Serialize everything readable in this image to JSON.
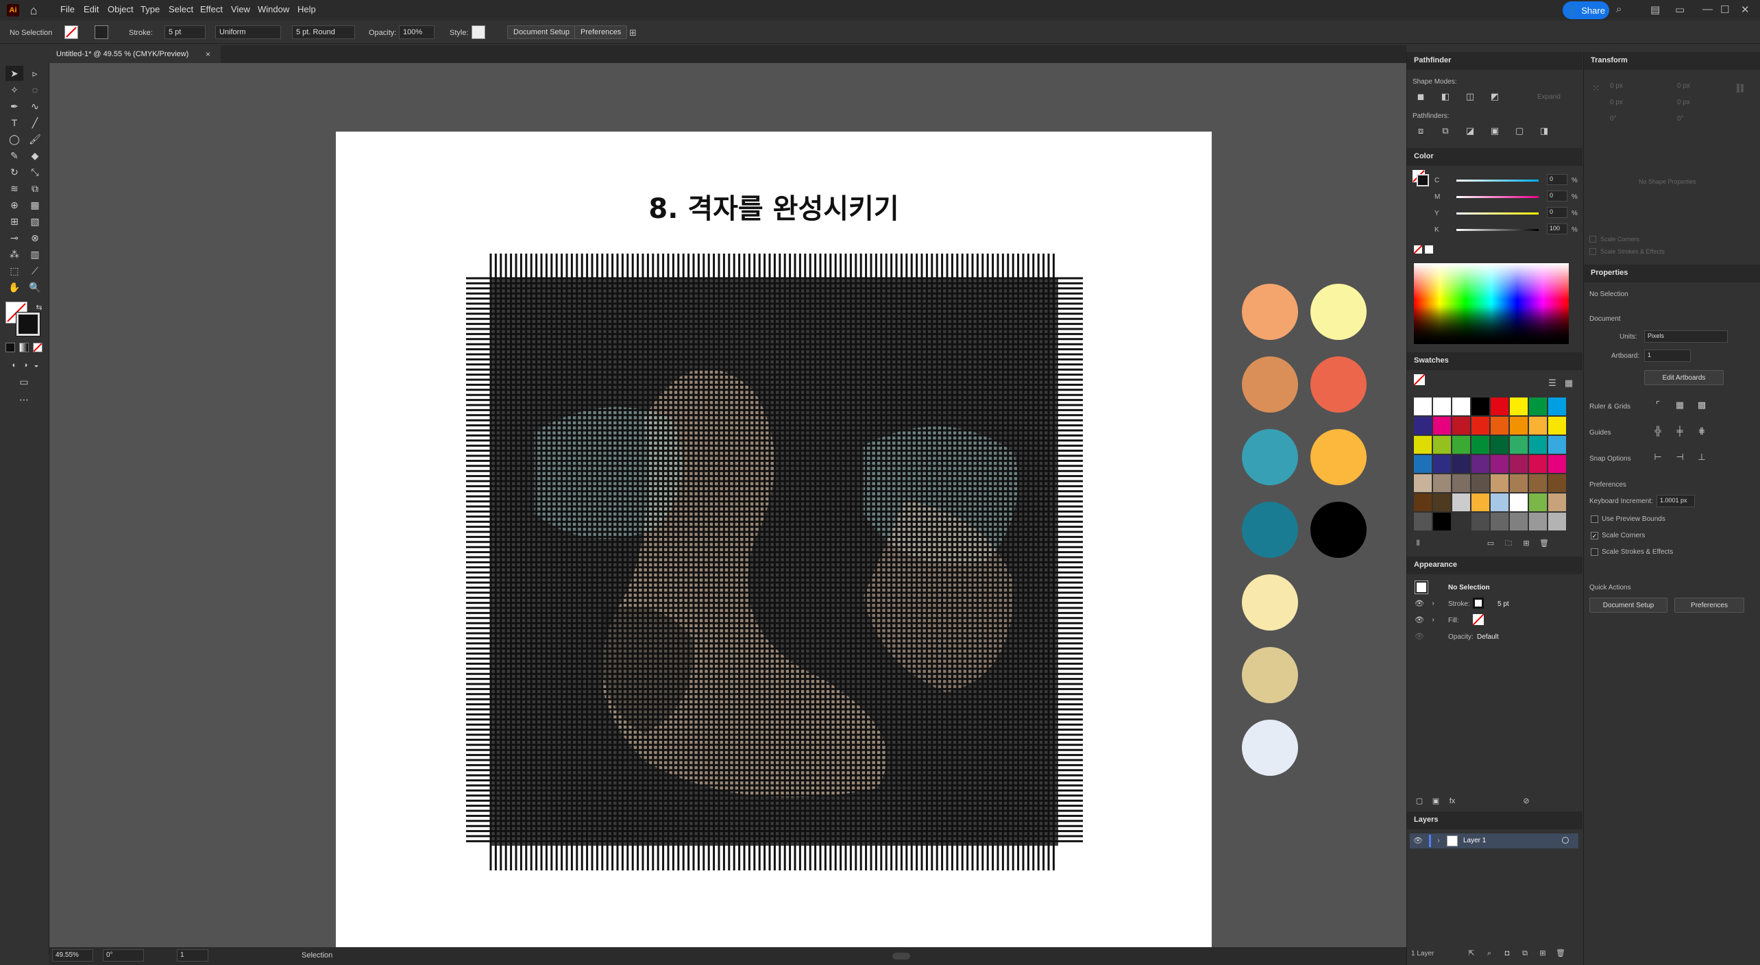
{
  "app": {
    "logo": "Ai",
    "menu": [
      "File",
      "Edit",
      "Object",
      "Type",
      "Select",
      "Effect",
      "View",
      "Window",
      "Help"
    ],
    "share_label": "Share"
  },
  "control_bar": {
    "selection_status": "No Selection",
    "stroke_label": "Stroke:",
    "stroke_value": "5 pt",
    "profile_value": "Uniform",
    "brush_value": "5 pt. Round",
    "opacity_label": "Opacity:",
    "opacity_value": "100%",
    "style_label": "Style:",
    "document_setup": "Document Setup",
    "preferences": "Preferences"
  },
  "document": {
    "tab_title": "Untitled-1* @ 49.55 % (CMYK/Preview)",
    "artboard_title": "8. 격자를 완성시키기"
  },
  "palette": {
    "colors": [
      "#f4a56e",
      "#faf5a0",
      "#da8f58",
      "#ec664b",
      "#38a0b4",
      "#fbb83c",
      "#1a7c93",
      "#000000",
      "#f9e8ac",
      "#decb92",
      "#e6ecf5"
    ]
  },
  "status_bar": {
    "zoom": "49.55%",
    "rotation": "0°",
    "artboard_num": "1",
    "tool_name": "Selection"
  },
  "pathfinder": {
    "title": "Pathfinder",
    "shape_modes_label": "Shape Modes:",
    "pathfinders_label": "Pathfinders:",
    "expand_label": "Expand"
  },
  "color_panel": {
    "title": "Color",
    "channels": [
      {
        "name": "C",
        "value": "0"
      },
      {
        "name": "M",
        "value": "0"
      },
      {
        "name": "Y",
        "value": "0"
      },
      {
        "name": "K",
        "value": "100"
      }
    ],
    "unit": "%"
  },
  "swatches": {
    "title": "Swatches",
    "rows": [
      [
        "#ffffff",
        "#ffffff",
        "#ffffff",
        "#000000",
        "#e30613",
        "#ffed00",
        "#009640",
        "#009fe3"
      ],
      [
        "#312783",
        "#e6007e",
        "#be1622",
        "#e42313",
        "#e95d0f",
        "#f39200",
        "#f9b233",
        "#f8e600"
      ],
      [
        "#dedc00",
        "#95c11f",
        "#3aaa35",
        "#008d36",
        "#006633",
        "#2fac66",
        "#00a19a",
        "#36a9e1"
      ],
      [
        "#1d71b8",
        "#2d2e83",
        "#29235c",
        "#662483",
        "#951b81",
        "#a3195b",
        "#d60b52",
        "#e6007e"
      ],
      [
        "#c8b39a",
        "#9d8a76",
        "#7c6e63",
        "#5f5248",
        "#c69c6d",
        "#a67c52",
        "#8c6239",
        "#754c24"
      ],
      [
        "#603813",
        "#4e3a1e",
        "#cccccc",
        "#f9b233",
        "#a7c7e7",
        "#ffffff",
        "#7ab648",
        "#c8a27a"
      ],
      [
        "#555555",
        "#000000",
        "#333333",
        "#4d4d4d",
        "#666666",
        "#808080",
        "#999999",
        "#b3b3b3"
      ]
    ]
  },
  "appearance": {
    "title": "Appearance",
    "selection": "No Selection",
    "stroke_label": "Stroke:",
    "stroke_value": "5 pt",
    "fill_label": "Fill:",
    "opacity_label": "Opacity:",
    "opacity_value": "Default"
  },
  "layers": {
    "title": "Layers",
    "items": [
      "Layer 1"
    ],
    "count": "1 Layer"
  },
  "transform": {
    "title": "Transform",
    "x": "0 px",
    "y": "0 px",
    "w": "0 px",
    "h": "0 px",
    "angle": "0°",
    "shear": "0°",
    "no_shape": "No Shape Properties",
    "scale_corners": "Scale Corners",
    "scale_strokes": "Scale Strokes & Effects"
  },
  "properties": {
    "title": "Properties",
    "selection": "No Selection",
    "document_label": "Document",
    "units_label": "Units:",
    "units_value": "Pixels",
    "artboard_label": "Artboard:",
    "artboard_value": "1",
    "edit_artboards": "Edit Artboards",
    "ruler_grids": "Ruler & Grids",
    "guides": "Guides",
    "snap_options": "Snap Options",
    "preferences_label": "Preferences",
    "keyboard_increment_label": "Keyboard Increment:",
    "keyboard_increment_value": "1.0001 px",
    "use_preview_bounds": "Use Preview Bounds",
    "scale_corners": "Scale Corners",
    "scale_strokes": "Scale Strokes & Effects",
    "quick_actions": "Quick Actions",
    "document_setup_btn": "Document Setup",
    "preferences_btn": "Preferences"
  }
}
